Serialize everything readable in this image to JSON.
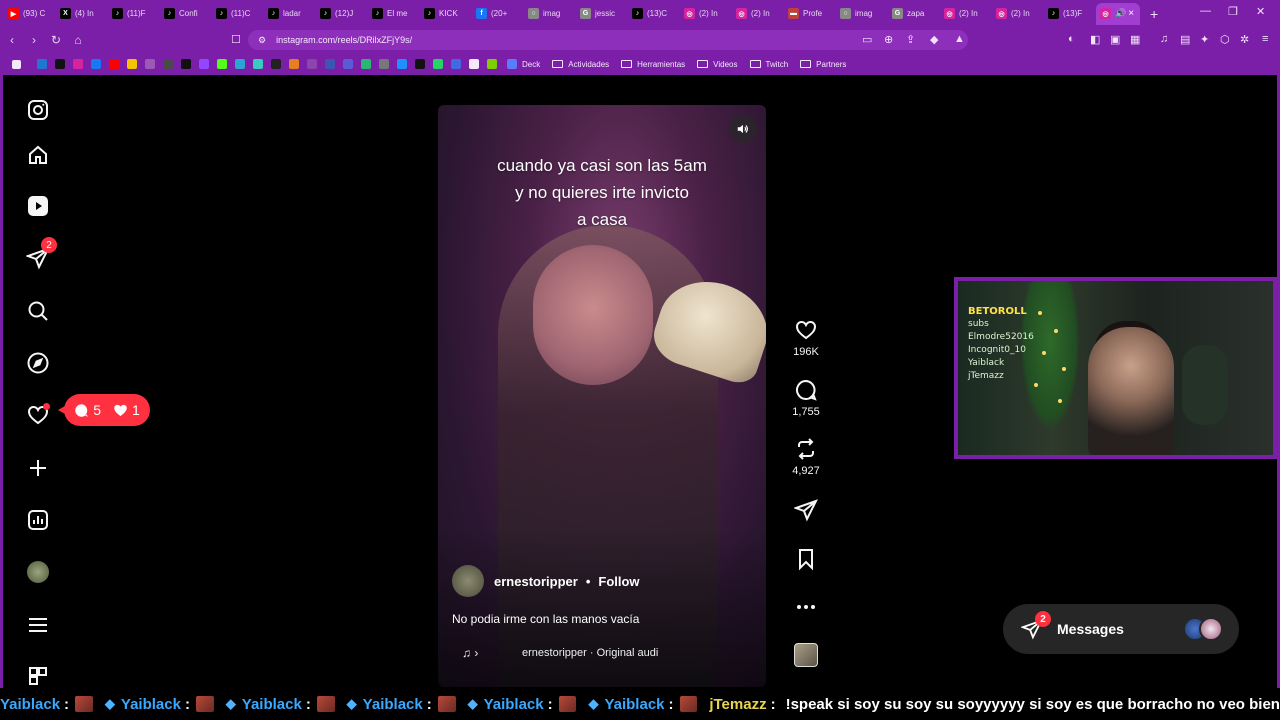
{
  "browser": {
    "tabs": [
      {
        "label": "(93) C",
        "fav_color": "#ff0000",
        "fav": "▶"
      },
      {
        "label": "(4) In",
        "fav_color": "#000000",
        "fav": "X"
      },
      {
        "label": "(11)F",
        "fav_color": "#000000",
        "fav": "♪"
      },
      {
        "label": "Confi",
        "fav_color": "#000000",
        "fav": "♪"
      },
      {
        "label": "(11)C",
        "fav_color": "#000000",
        "fav": "♪"
      },
      {
        "label": "ladar",
        "fav_color": "#000000",
        "fav": "♪"
      },
      {
        "label": "(12)J",
        "fav_color": "#000000",
        "fav": "♪"
      },
      {
        "label": "El me",
        "fav_color": "#000000",
        "fav": "♪"
      },
      {
        "label": "KICK",
        "fav_color": "#000000",
        "fav": "♪"
      },
      {
        "label": "(20+",
        "fav_color": "#1877f2",
        "fav": "f"
      },
      {
        "label": "imag",
        "fav_color": "#888888",
        "fav": "○"
      },
      {
        "label": "jessic",
        "fav_color": "#888888",
        "fav": "G"
      },
      {
        "label": "(13)C",
        "fav_color": "#000000",
        "fav": "♪"
      },
      {
        "label": "(2) In",
        "fav_color": "#d6249f",
        "fav": "◎"
      },
      {
        "label": "(2) In",
        "fav_color": "#d6249f",
        "fav": "◎"
      },
      {
        "label": "Profe",
        "fav_color": "#c04040",
        "fav": "▬"
      },
      {
        "label": "imag",
        "fav_color": "#888888",
        "fav": "○"
      },
      {
        "label": "zapa",
        "fav_color": "#888888",
        "fav": "G"
      },
      {
        "label": "(2) In",
        "fav_color": "#d6249f",
        "fav": "◎"
      },
      {
        "label": "(2) In",
        "fav_color": "#d6249f",
        "fav": "◎"
      },
      {
        "label": "(13)F",
        "fav_color": "#000000",
        "fav": "♪"
      }
    ],
    "new_tab": "+",
    "url": "instagram.com/reels/DRilxZFjY9s/",
    "bookmarks": [
      "Deck",
      "Actividades",
      "Herramientas",
      "Videos",
      "Twitch",
      "Partners"
    ]
  },
  "sidebar": {
    "direct_badge": "2",
    "notif_comments": "5",
    "notif_likes": "1"
  },
  "reel": {
    "overlay_lines": [
      "cuando ya casi son las 5am",
      "y no quieres irte invicto",
      "a casa"
    ],
    "author": "ernestoripper",
    "separator": "•",
    "follow": "Follow",
    "caption": "No podia irme con las manos vacía",
    "audio": "ernestoripper · Original audi",
    "audio_prefix": "♫ ›",
    "likes": "196K",
    "comments": "1,755",
    "reposts": "4,927"
  },
  "webcam": {
    "lines": [
      "BETOROLL",
      "subs",
      "Elmodre52016",
      "Incognit0_10",
      "Yaiblack",
      "jTemazz"
    ]
  },
  "messages": {
    "label": "Messages",
    "badge": "2"
  },
  "ticker": {
    "repeat_name": "Yaiblack",
    "colon": ":",
    "user2": "jTemazz",
    "message": "!speak si soy su soy su soyyyyyy si soy es que borracho no veo bien"
  }
}
